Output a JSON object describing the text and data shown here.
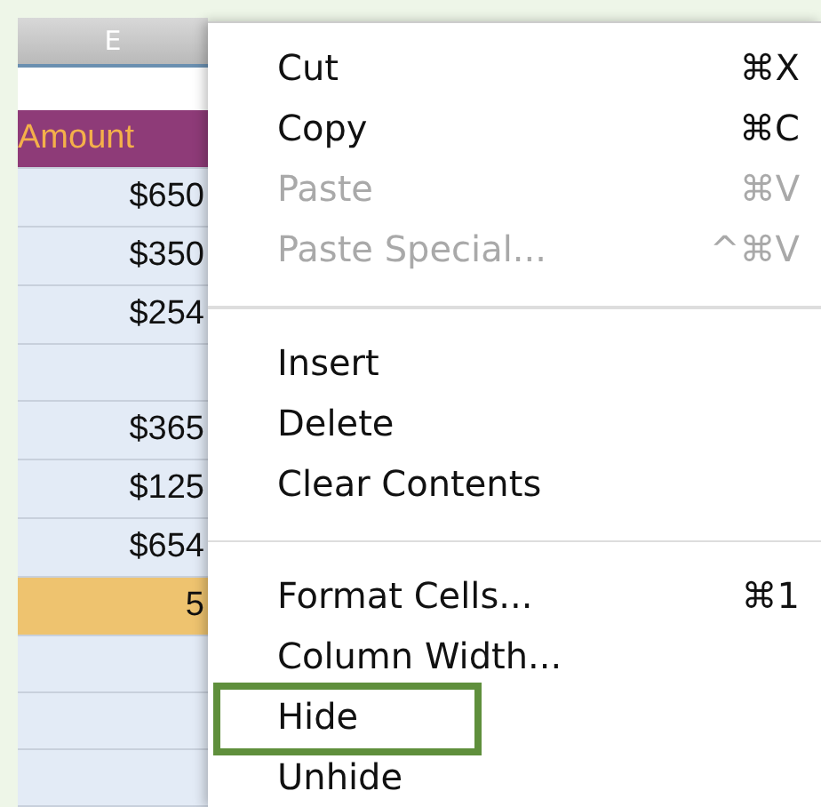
{
  "sheet": {
    "column_header": "E",
    "cells": [
      {
        "kind": "blank"
      },
      {
        "text": "Amount",
        "kind": "header"
      },
      {
        "text": "$650",
        "kind": "data"
      },
      {
        "text": "$350",
        "kind": "data"
      },
      {
        "text": "$254",
        "kind": "data"
      },
      {
        "kind": "data"
      },
      {
        "text": "$365",
        "kind": "data"
      },
      {
        "text": "$125",
        "kind": "data"
      },
      {
        "text": "$654",
        "kind": "data"
      },
      {
        "text": "5",
        "kind": "total"
      },
      {
        "kind": "data"
      },
      {
        "kind": "data"
      },
      {
        "kind": "data"
      }
    ]
  },
  "context_menu": {
    "items": [
      {
        "kind": "item",
        "label": "Cut",
        "shortcut": "⌘X",
        "disabled": false,
        "outlined": false
      },
      {
        "kind": "item",
        "label": "Copy",
        "shortcut": "⌘C",
        "disabled": false,
        "outlined": false
      },
      {
        "kind": "item",
        "label": "Paste",
        "shortcut": "⌘V",
        "disabled": true,
        "outlined": false
      },
      {
        "kind": "item",
        "label": "Paste Special...",
        "shortcut": "^⌘V",
        "disabled": true,
        "outlined": false
      },
      {
        "kind": "separator"
      },
      {
        "kind": "item",
        "label": "Insert",
        "disabled": false,
        "outlined": false
      },
      {
        "kind": "item",
        "label": "Delete",
        "disabled": false,
        "outlined": false
      },
      {
        "kind": "item",
        "label": "Clear Contents",
        "disabled": false,
        "outlined": false
      },
      {
        "kind": "separator"
      },
      {
        "kind": "item",
        "label": "Format Cells...",
        "shortcut": "⌘1",
        "disabled": false,
        "outlined": false
      },
      {
        "kind": "item",
        "label": "Column Width...",
        "disabled": false,
        "outlined": false
      },
      {
        "kind": "item",
        "label": "Hide",
        "disabled": false,
        "outlined": true
      },
      {
        "kind": "item",
        "label": "Unhide",
        "disabled": false,
        "outlined": false
      }
    ]
  }
}
